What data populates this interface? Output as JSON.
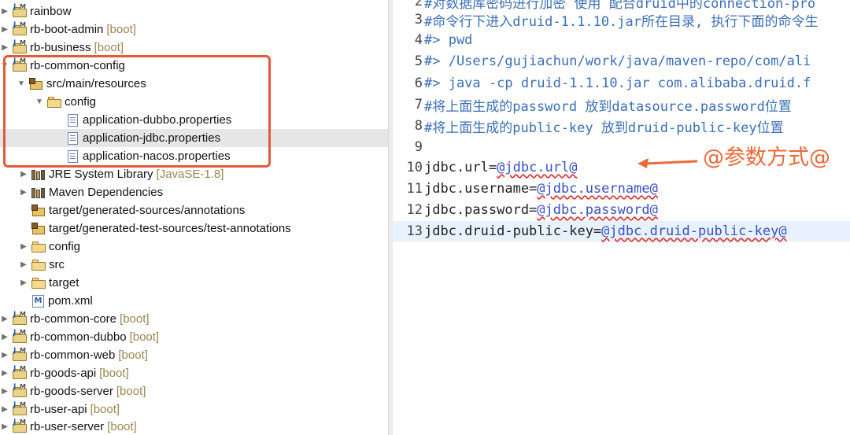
{
  "tree": {
    "rainbow": "rainbow",
    "rb_boot_admin": "rb-boot-admin",
    "rb_business": "rb-business",
    "rb_common_config": "rb-common-config",
    "src_main_resources": "src/main/resources",
    "config_folder": "config",
    "app_dubbo": "application-dubbo.properties",
    "app_jdbc": "application-jdbc.properties",
    "app_nacos": "application-nacos.properties",
    "jre_lib": "JRE System Library",
    "jre_tag": "[JavaSE-1.8]",
    "maven_deps": "Maven Dependencies",
    "gen_sources": "target/generated-sources/annotations",
    "gen_test_sources": "target/generated-test-sources/test-annotations",
    "config2": "config",
    "src": "src",
    "target": "target",
    "pom": "pom.xml",
    "rb_common_core": "rb-common-core",
    "rb_common_dubbo": "rb-common-dubbo",
    "rb_common_web": "rb-common-web",
    "rb_goods_api": "rb-goods-api",
    "rb_goods_server": "rb-goods-server",
    "rb_user_api": "rb-user-api",
    "rb_user_server": "rb-user-server",
    "boot_tag": "[boot]"
  },
  "editor": {
    "lines": [
      {
        "n": "2",
        "text": "#对数据库密码进行加密 使用 配合druid中的connection-pro"
      },
      {
        "n": "3",
        "text": "#命令行下进入druid-1.1.10.jar所在目录, 执行下面的命令生"
      },
      {
        "n": "4",
        "text": "#> pwd"
      },
      {
        "n": "5",
        "text": "#> /Users/gujiachun/work/java/maven-repo/com/ali"
      },
      {
        "n": "6",
        "text": "#> java -cp druid-1.1.10.jar com.alibaba.druid.f"
      },
      {
        "n": "7",
        "text": "#将上面生成的password 放到datasource.password位置"
      },
      {
        "n": "8",
        "text": "#将上面生成的public-key 放到druid-public-key位置"
      },
      {
        "n": "9",
        "text": ""
      },
      {
        "n": "10",
        "key": "jdbc.url=",
        "val": "@jdbc.url@"
      },
      {
        "n": "11",
        "key": "jdbc.username=",
        "val": "@jdbc.username@"
      },
      {
        "n": "12",
        "key": "jdbc.password=",
        "val": "@jdbc.password@"
      },
      {
        "n": "13",
        "key": "jdbc.druid-public-key=",
        "val": "@jdbc.druid-public-key@"
      }
    ]
  },
  "annotation": "@参数方式@",
  "colors": {
    "annotation": "#ec6a3a",
    "highlight_box": "#e35a3a",
    "comment": "#3b6fb6",
    "placeholder": "#3a4fc4"
  }
}
